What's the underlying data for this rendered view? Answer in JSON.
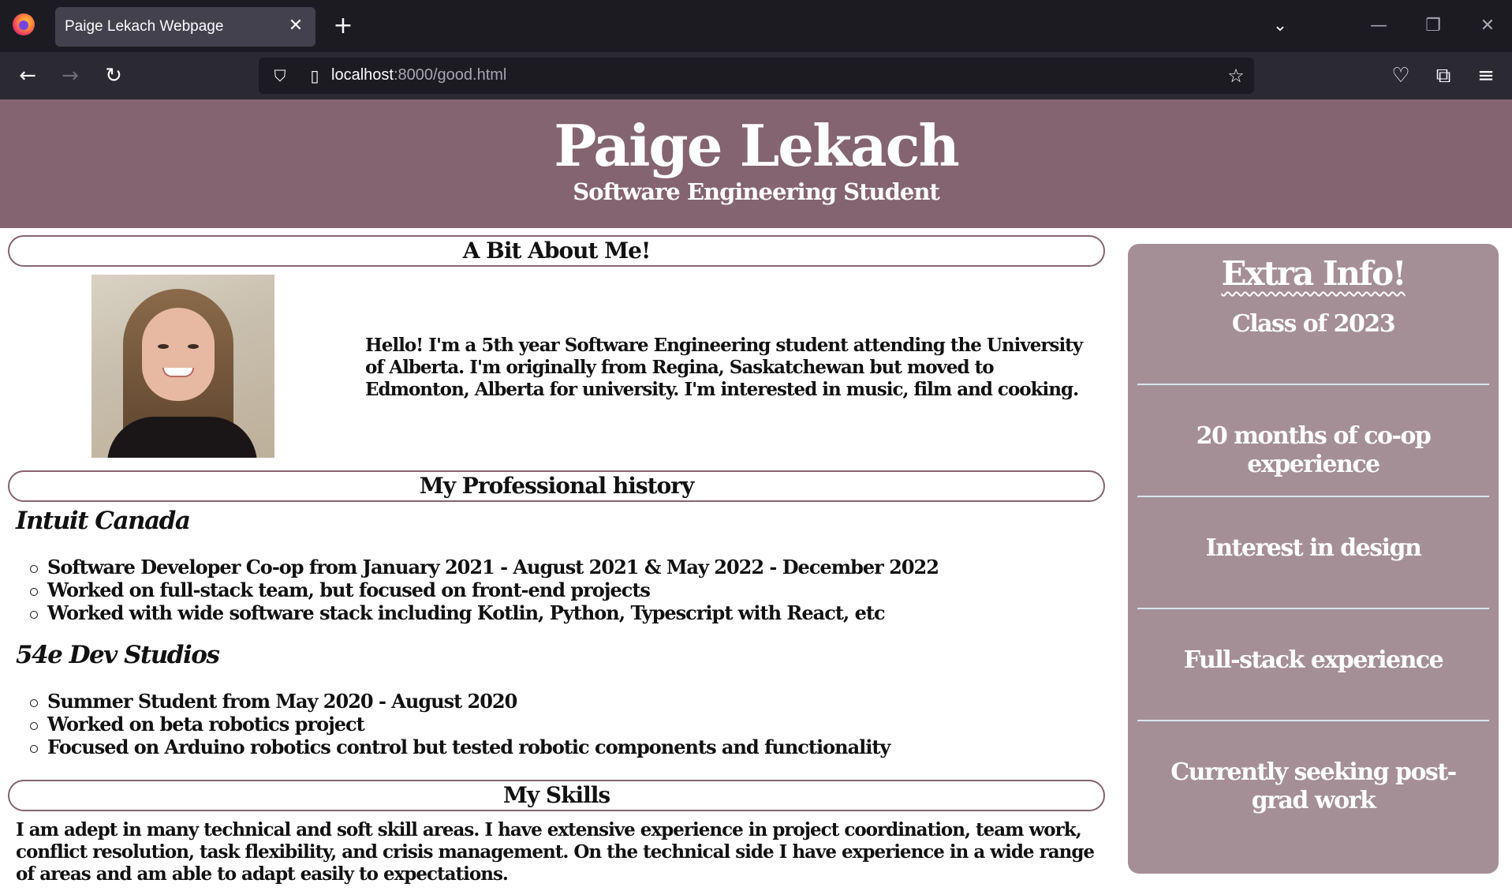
{
  "browser": {
    "tab_title": "Paige Lekach Webpage",
    "close_glyph": "✕",
    "new_tab_glyph": "+",
    "list_tabs_glyph": "⌄",
    "minimize_glyph": "—",
    "restore_glyph": "❐",
    "close_window_glyph": "✕",
    "back_glyph": "←",
    "forward_glyph": "→",
    "reload_glyph": "↻",
    "url_host": "localhost",
    "url_rest": ":8000/good.html",
    "shield_glyph": "⛉",
    "page_glyph": "▯",
    "star_glyph": "☆",
    "pocket_glyph": "♡",
    "extensions_glyph": "⧉",
    "menu_glyph": "≡"
  },
  "header": {
    "title": "Paige Lekach",
    "subtitle": "Software Engineering Student",
    "background": "#846470"
  },
  "about": {
    "heading": "A Bit About Me!",
    "text": "Hello! I'm a 5th year Software Engineering student attending the University of Alberta. I'm originally from Regina, Saskatchewan but moved to Edmonton, Alberta for university. I'm interested in music, film and cooking."
  },
  "history": {
    "heading": "My Professional history",
    "jobs": [
      {
        "company": "Intuit Canada",
        "points": [
          "Software Developer Co-op from January 2021 - August 2021 & May 2022 - December 2022",
          "Worked on full-stack team, but focused on front-end projects",
          "Worked with wide software stack including Kotlin, Python, Typescript with React, etc"
        ]
      },
      {
        "company": "54e Dev Studios",
        "points": [
          "Summer Student from May 2020 - August 2020",
          "Worked on beta robotics project",
          "Focused on Arduino robotics control but tested robotic components and functionality"
        ]
      }
    ]
  },
  "skills": {
    "heading": "My Skills",
    "text": "I am adept in many technical and soft skill areas. I have extensive experience in project coordination, team work, conflict resolution, task flexibility, and crisis management. On the technical side I have experience in a wide range of areas and am able to adapt easily to expectations."
  },
  "sidebar": {
    "title": "Extra Info!",
    "background": "#a58f97",
    "facts": [
      "Class of 2023",
      "20 months of co-op experience",
      "Interest in design",
      "Full-stack experience",
      "Currently seeking post-grad work"
    ]
  }
}
